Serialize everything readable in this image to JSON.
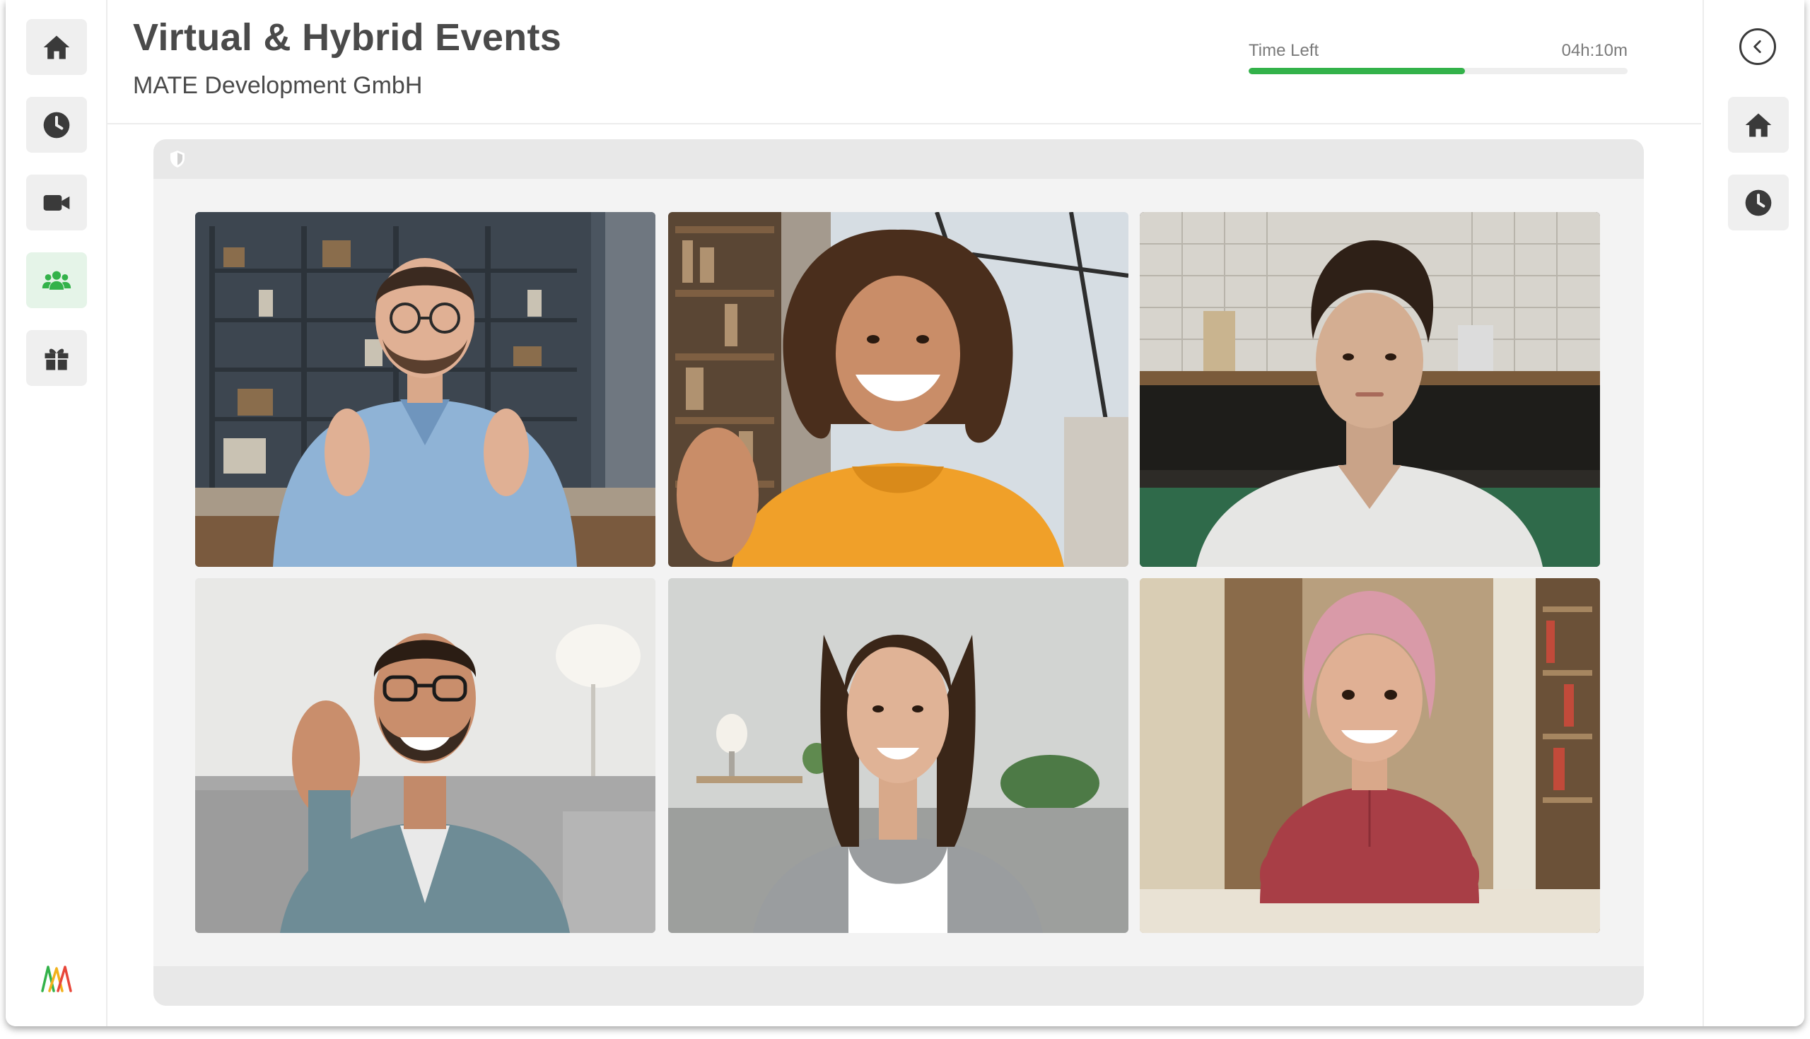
{
  "header": {
    "title": "Virtual & Hybrid Events",
    "organization": "MATE Development GmbH"
  },
  "timer": {
    "label": "Time Left",
    "value": "04h:10m",
    "progress_fraction": 0.57,
    "color": "#33b24a"
  },
  "left_nav": {
    "items": [
      {
        "icon": "home-icon",
        "active": false
      },
      {
        "icon": "clock-icon",
        "active": false
      },
      {
        "icon": "video-camera-icon",
        "active": false
      },
      {
        "icon": "users-icon",
        "active": true
      },
      {
        "icon": "gift-icon",
        "active": false
      }
    ],
    "logo": "mate-logo"
  },
  "right_nav": {
    "items": [
      {
        "icon": "chevron-left-icon"
      },
      {
        "icon": "home-icon"
      },
      {
        "icon": "clock-icon"
      }
    ]
  },
  "stage": {
    "security_icon": "shield-icon",
    "participants": [
      {
        "description": "man with glasses, light blue shirt, bookshelf background",
        "icon": "participant-video"
      },
      {
        "description": "curly-haired woman, orange hoodie, waving",
        "icon": "participant-video"
      },
      {
        "description": "man in white t-shirt, kitchen background",
        "icon": "participant-video"
      },
      {
        "description": "bearded man with glasses, denim shirt, waving",
        "icon": "participant-video"
      },
      {
        "description": "woman, grey cardigan, living room",
        "icon": "participant-video"
      },
      {
        "description": "pink-haired woman, red blouse, arms crossed",
        "icon": "participant-video"
      }
    ]
  },
  "colors": {
    "accent": "#33b24a",
    "nav_bg": "#efefef",
    "nav_active_bg": "#e5f4e8",
    "text": "#4a4a4a"
  }
}
